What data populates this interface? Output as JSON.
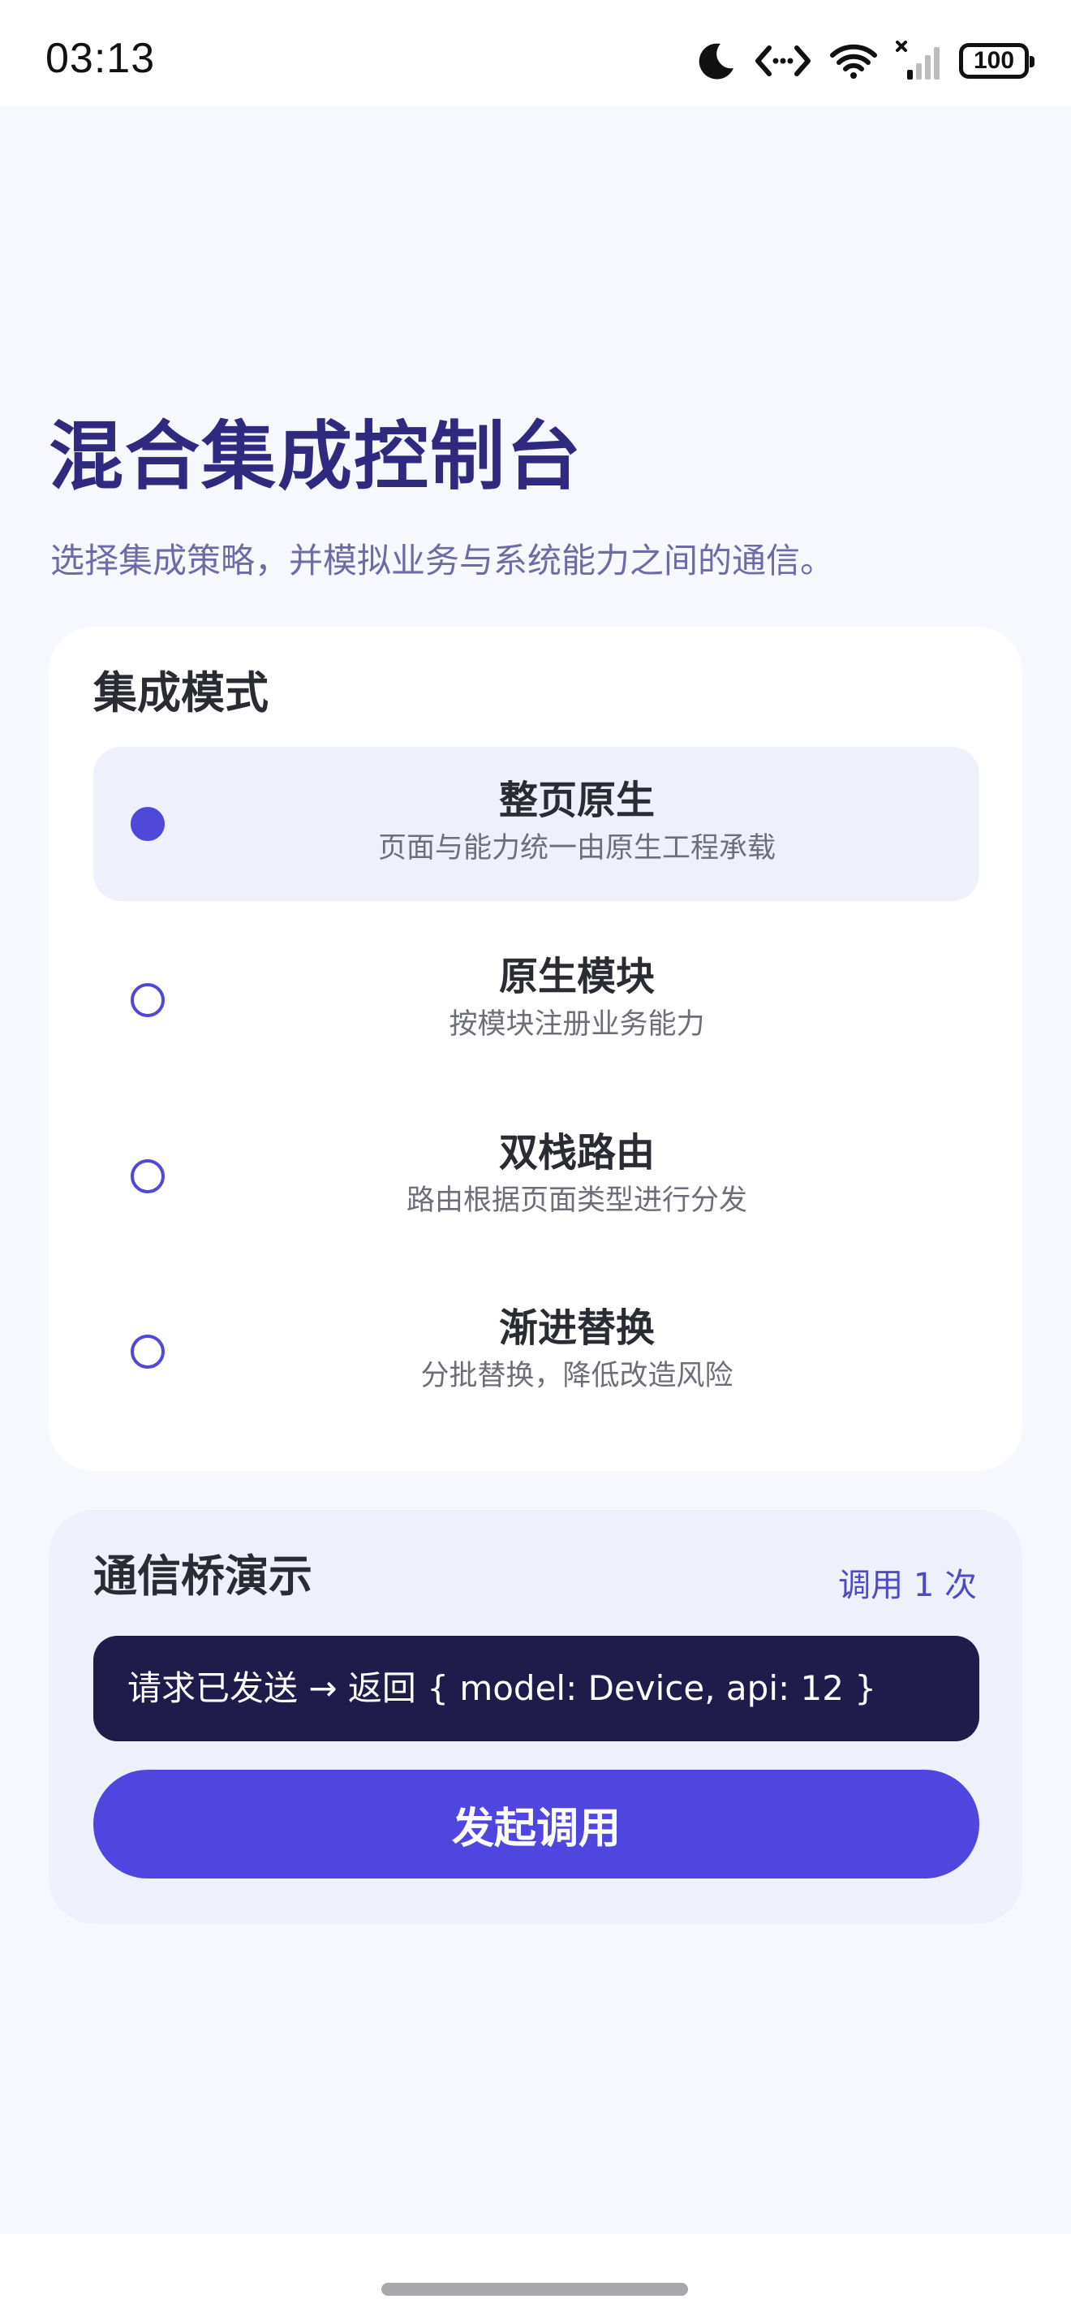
{
  "status_bar": {
    "time": "03:13",
    "battery": "100",
    "icons": [
      "moon-icon",
      "dev-tools-icon",
      "wifi-icon",
      "cellular-signal-icon",
      "battery-icon"
    ]
  },
  "header": {
    "title": "混合集成控制台",
    "subtitle": "选择集成策略，并模拟业务与系统能力之间的通信。"
  },
  "modes": {
    "title": "集成模式",
    "selected_index": 0,
    "options": [
      {
        "title": "整页原生",
        "desc": "页面与能力统一由原生工程承载"
      },
      {
        "title": "原生模块",
        "desc": "按模块注册业务能力"
      },
      {
        "title": "双栈路由",
        "desc": "路由根据页面类型进行分发"
      },
      {
        "title": "渐进替换",
        "desc": "分批替换，降低改造风险"
      }
    ]
  },
  "bridge": {
    "title": "通信桥演示",
    "call_count": "调用 1 次",
    "response": "请求已发送 → 返回 { model: Device, api: 12 }",
    "invoke_label": "发起调用"
  },
  "colors": {
    "accent": "#4f46e0",
    "title": "#2f2a7f",
    "response_bg": "#1f1b4a",
    "page_bg": "#f7f8fe",
    "selected_bg": "#eef0fc"
  }
}
